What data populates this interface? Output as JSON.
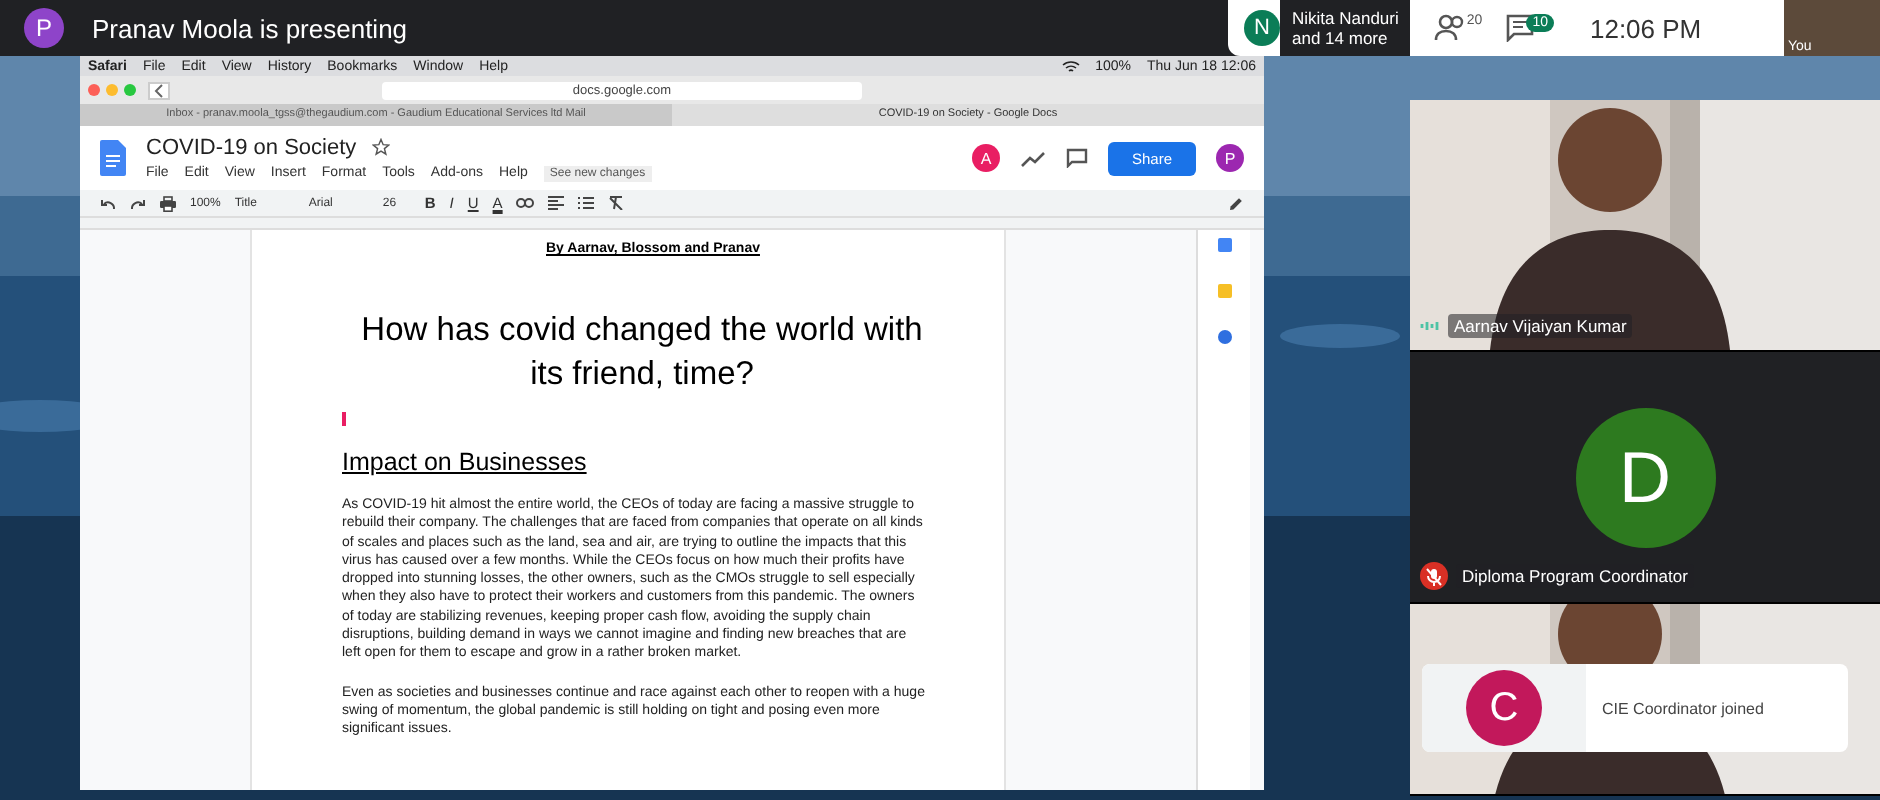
{
  "top_bar": {
    "presenter_initial": "P",
    "presenter_text": "Pranav Moola is presenting",
    "participant_initial": "N",
    "participant_name": "Nikita Nanduri",
    "participant_more": "and 14 more",
    "people_count": "20",
    "chat_count": "10",
    "time": "12:06 PM",
    "self_label": "You"
  },
  "shared_screen": {
    "mac_menu": {
      "app": "Safari",
      "items": [
        "File",
        "Edit",
        "View",
        "History",
        "Bookmarks",
        "Window",
        "Help"
      ],
      "battery": "100%",
      "clock": "Thu Jun 18  12:06"
    },
    "address": "docs.google.com",
    "tabs": [
      {
        "label": "Inbox - pranav.moola_tgss@thegaudium.com - Gaudium Educational Services ltd Mail",
        "selected": false
      },
      {
        "label": "COVID-19 on Society - Google Docs",
        "selected": true
      }
    ],
    "doc_title": "COVID-19 on Society",
    "doc_menu": [
      "File",
      "Edit",
      "View",
      "Insert",
      "Format",
      "Tools",
      "Add-ons",
      "Help"
    ],
    "see_changes": "See new changes",
    "collaborator_initial": "A",
    "user_initial": "P",
    "share": "Share",
    "toolbar": {
      "zoom": "100%",
      "style": "Title",
      "font": "Arial",
      "size": "26",
      "format_letters": [
        "B",
        "I",
        "U",
        "A"
      ]
    },
    "document": {
      "byline": "By Aarnav, Blossom and Pranav",
      "heading": "How has covid changed the world with its friend, time?",
      "section": "Impact on Businesses",
      "paragraphs": [
        "As COVID-19 hit almost the entire world, the CEOs of today are facing a massive struggle to rebuild their company. The challenges that are faced from companies that operate on all kinds of scales and places such as the land, sea and air, are trying to outline the impacts that this virus has caused over a few months. While the CEOs focus on how much their profits have dropped into stunning losses, the other owners, such as the CMOs struggle to sell especially when they also have to protect their workers and customers from this pandemic. The owners of today are stabilizing revenues, keeping proper cash flow, avoiding the supply chain disruptions, building demand in ways we cannot imagine and finding new breaches that are left open for them to escape and grow in a rather broken market.",
        "Even as societies and businesses continue and race against each other to reopen with a huge swing of momentum, the global pandemic is still holding on tight and posing even more significant issues."
      ]
    }
  },
  "tiles": [
    {
      "kind": "video",
      "name": "Aarnav Vijaiyan Kumar",
      "muted": false
    },
    {
      "kind": "avatar",
      "initial": "D",
      "color": "#2d7a1f",
      "name": "Diploma Program Coordinator",
      "muted": true
    },
    {
      "kind": "video"
    }
  ],
  "toast": {
    "initial": "C",
    "text": "CIE Coordinator joined"
  }
}
